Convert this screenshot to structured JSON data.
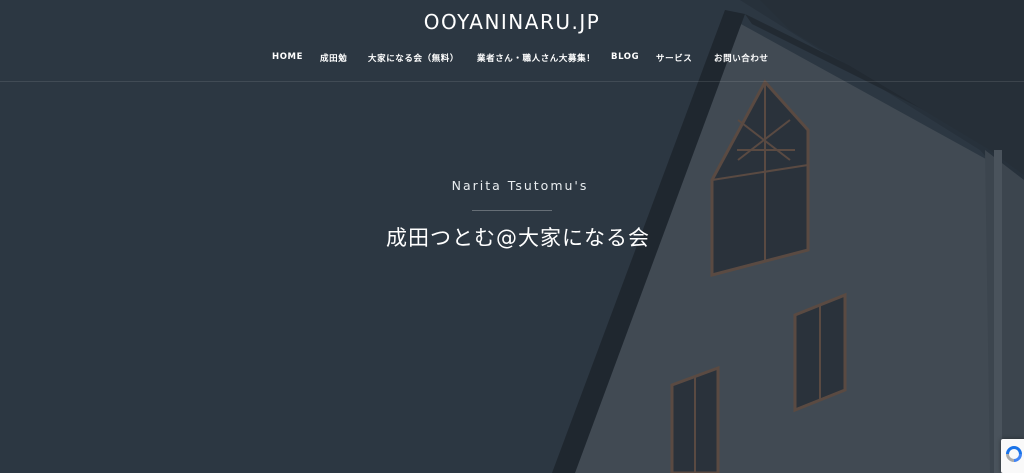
{
  "site": {
    "title": "OOYANINARU.JP"
  },
  "nav": {
    "items": [
      {
        "label": "HOME"
      },
      {
        "label": "成田勉"
      },
      {
        "label": "大家になる会（無料）"
      },
      {
        "label": "業者さん・職人さん大募集！"
      },
      {
        "label": "BLOG"
      },
      {
        "label": "サービス"
      },
      {
        "label": "お問い合わせ"
      }
    ]
  },
  "hero": {
    "subtitle": "Narita Tsutomu's",
    "title": "成田つとむ@大家になる会"
  },
  "colors": {
    "overlay": "#2c3742",
    "text": "#ffffff",
    "recaptcha": "#1a73e8"
  },
  "icons": {
    "recaptcha": "recaptcha-icon"
  }
}
